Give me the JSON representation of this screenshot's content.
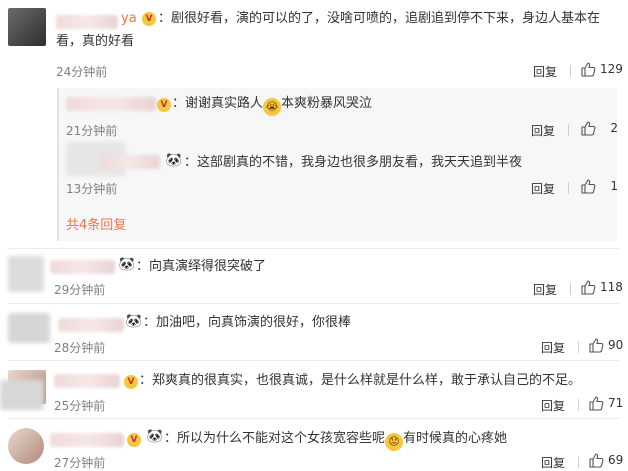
{
  "comments": [
    {
      "name_suffix": "ya",
      "badge": "V",
      "text_line1": "：剧很好看，演的可以的了，没啥可喷的，追剧追到停不下来，身边人基本在",
      "text_line2": "看，真的好看",
      "time": "24分钟前",
      "reply_label": "回复",
      "likes": "129"
    },
    {
      "text": "：向真演绎得很突破了",
      "time": "29分钟前",
      "reply_label": "回复",
      "likes": "118"
    },
    {
      "text": "：加油吧，向真饰演的很好，你很棒",
      "time": "28分钟前",
      "reply_label": "回复",
      "likes": "90"
    },
    {
      "text": "：郑爽真的很真实，也很真诚，是什么样就是什么样，敢于承认自己的不足。",
      "time": "25分钟前",
      "reply_label": "回复",
      "likes": "71"
    },
    {
      "text_a": "：所以为什么不能对这个女孩宽容些呢",
      "text_b": "有时候真的心疼她",
      "time": "27分钟前",
      "reply_label": "回复",
      "likes": "69"
    }
  ],
  "replies": [
    {
      "text_a": "：谢谢真实路人",
      "text_b": "本爽粉暴风哭泣",
      "time": "21分钟前",
      "reply_label": "回复",
      "likes": "2"
    },
    {
      "text": "：这部剧真的不错，我身边也很多朋友看，我天天追到半夜",
      "time": "13分钟前",
      "reply_label": "回复",
      "likes": "1"
    }
  ],
  "more_replies": "共4条回复",
  "icons": {
    "like": "thumbs-up-icon",
    "panda": "panda-emoji-icon",
    "cry": "crying-face-emoji",
    "worried": "worried-face-emoji"
  },
  "colors": {
    "more_link": "#eb7350",
    "meta": "#808080",
    "text": "#333333"
  }
}
